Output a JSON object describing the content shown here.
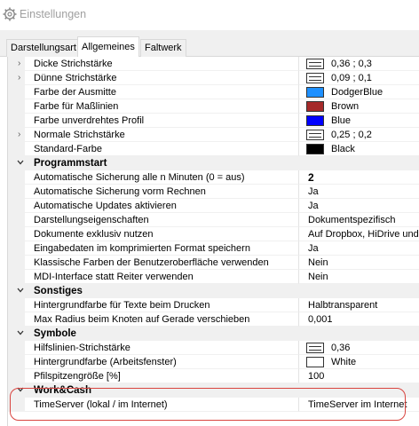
{
  "window": {
    "title": "Einstellungen",
    "icon": "gear-icon"
  },
  "tabs": [
    {
      "label": "Darstellungsart",
      "active": false
    },
    {
      "label": "Allgemeines",
      "active": true
    },
    {
      "label": "Faltwerk",
      "active": false
    }
  ],
  "rows": [
    {
      "type": "prop",
      "expand": true,
      "name": "Dicke Strichstärke",
      "swatch": "lines",
      "value": "0,36 ; 0,3"
    },
    {
      "type": "prop",
      "expand": true,
      "name": "Dünne Strichstärke",
      "swatch": "lines",
      "value": "0,09 ; 0,1"
    },
    {
      "type": "prop",
      "expand": false,
      "name": "Farbe der Ausmitte",
      "swatch": "#1e90ff",
      "value": "DodgerBlue"
    },
    {
      "type": "prop",
      "expand": false,
      "name": "Farbe für Maßlinien",
      "swatch": "#a52a2a",
      "value": "Brown"
    },
    {
      "type": "prop",
      "expand": false,
      "name": "Farbe unverdrehtes Profil",
      "swatch": "#0000ff",
      "value": "Blue"
    },
    {
      "type": "prop",
      "expand": true,
      "name": "Normale Strichstärke",
      "swatch": "lines",
      "value": "0,25 ; 0,2"
    },
    {
      "type": "prop",
      "expand": false,
      "name": "Standard-Farbe",
      "swatch": "#000000",
      "value": "Black"
    },
    {
      "type": "cat",
      "name": "Programmstart"
    },
    {
      "type": "prop",
      "expand": false,
      "name": "Automatische Sicherung alle n Minuten (0 = aus)",
      "value": "2",
      "bold": true
    },
    {
      "type": "prop",
      "expand": false,
      "name": "Automatische Sicherung vorm Rechnen",
      "value": "Ja"
    },
    {
      "type": "prop",
      "expand": false,
      "name": "Automatische Updates aktivieren",
      "value": "Ja"
    },
    {
      "type": "prop",
      "expand": false,
      "name": "Darstellungseigenschaften",
      "value": "Dokumentspezifisch"
    },
    {
      "type": "prop",
      "expand": false,
      "name": "Dokumente exklusiv nutzen",
      "value": "Auf Dropbox, HiDrive und G"
    },
    {
      "type": "prop",
      "expand": false,
      "name": "Eingabedaten im komprimierten Format speichern",
      "value": "Ja"
    },
    {
      "type": "prop",
      "expand": false,
      "name": "Klassische Farben der Benutzeroberfläche verwenden",
      "value": "Nein"
    },
    {
      "type": "prop",
      "expand": false,
      "name": "MDI-Interface statt Reiter verwenden",
      "value": "Nein"
    },
    {
      "type": "cat",
      "name": "Sonstiges"
    },
    {
      "type": "prop",
      "expand": false,
      "name": "Hintergrundfarbe für Texte beim Drucken",
      "value": "Halbtransparent"
    },
    {
      "type": "prop",
      "expand": false,
      "name": "Max Radius beim Knoten auf Gerade verschieben",
      "value": "0,001"
    },
    {
      "type": "cat",
      "name": "Symbole"
    },
    {
      "type": "prop",
      "expand": false,
      "name": "Hilfslinien-Strichstärke",
      "swatch": "lines",
      "value": "0,36"
    },
    {
      "type": "prop",
      "expand": false,
      "name": "Hintergrundfarbe (Arbeitsfenster)",
      "swatch": "#ffffff",
      "value": "White"
    },
    {
      "type": "prop",
      "expand": false,
      "name": "Pfilspitzengröße [%]",
      "value": "100"
    },
    {
      "type": "cat",
      "name": "Work&Cash"
    },
    {
      "type": "prop",
      "expand": false,
      "name": "TimeServer (lokal / im Internet)",
      "value": "TimeServer im Internet"
    }
  ]
}
